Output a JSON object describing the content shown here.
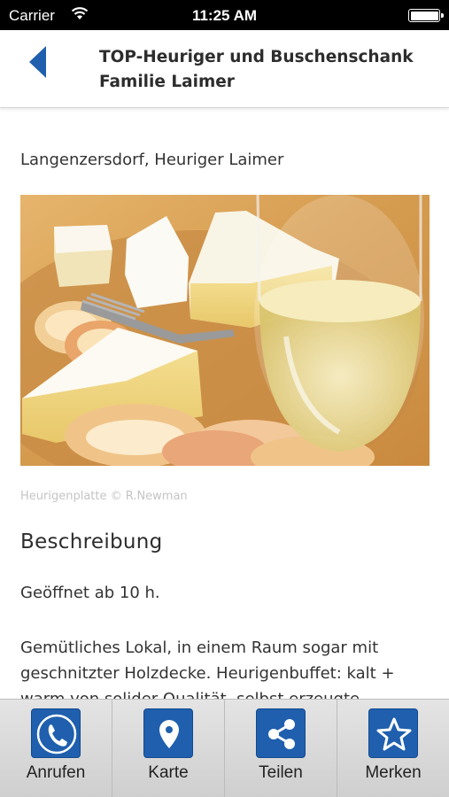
{
  "status_bar": {
    "carrier": "Carrier",
    "time": "11:25 AM",
    "wifi_icon": "wifi-icon",
    "battery_icon": "battery-icon"
  },
  "header": {
    "back_icon": "chevron-left-icon",
    "title": "TOP-Heuriger und Buschenschank Familie Laimer",
    "accent_color": "#1f5fae"
  },
  "content": {
    "location": "Langenzersdorf, Heuriger Laimer",
    "photo_alt": "Heurigenplatte",
    "photo_caption": "Heurigenplatte © R.Newman",
    "section_heading": "Beschreibung",
    "opening": "Geöffnet ab 10 h.",
    "description": "Gemütliches Lokal, in einem Raum sogar mit geschnitzter Holzdecke. Heurigenbuffet: kalt + warm von solider Qualität, selbst erzeugte"
  },
  "tabbar": {
    "tabs": [
      {
        "label": "Anrufen",
        "icon": "phone-icon"
      },
      {
        "label": "Karte",
        "icon": "map-pin-icon"
      },
      {
        "label": "Teilen",
        "icon": "share-icon"
      },
      {
        "label": "Merken",
        "icon": "star-icon"
      }
    ],
    "icon_color": "#1f5fae"
  }
}
